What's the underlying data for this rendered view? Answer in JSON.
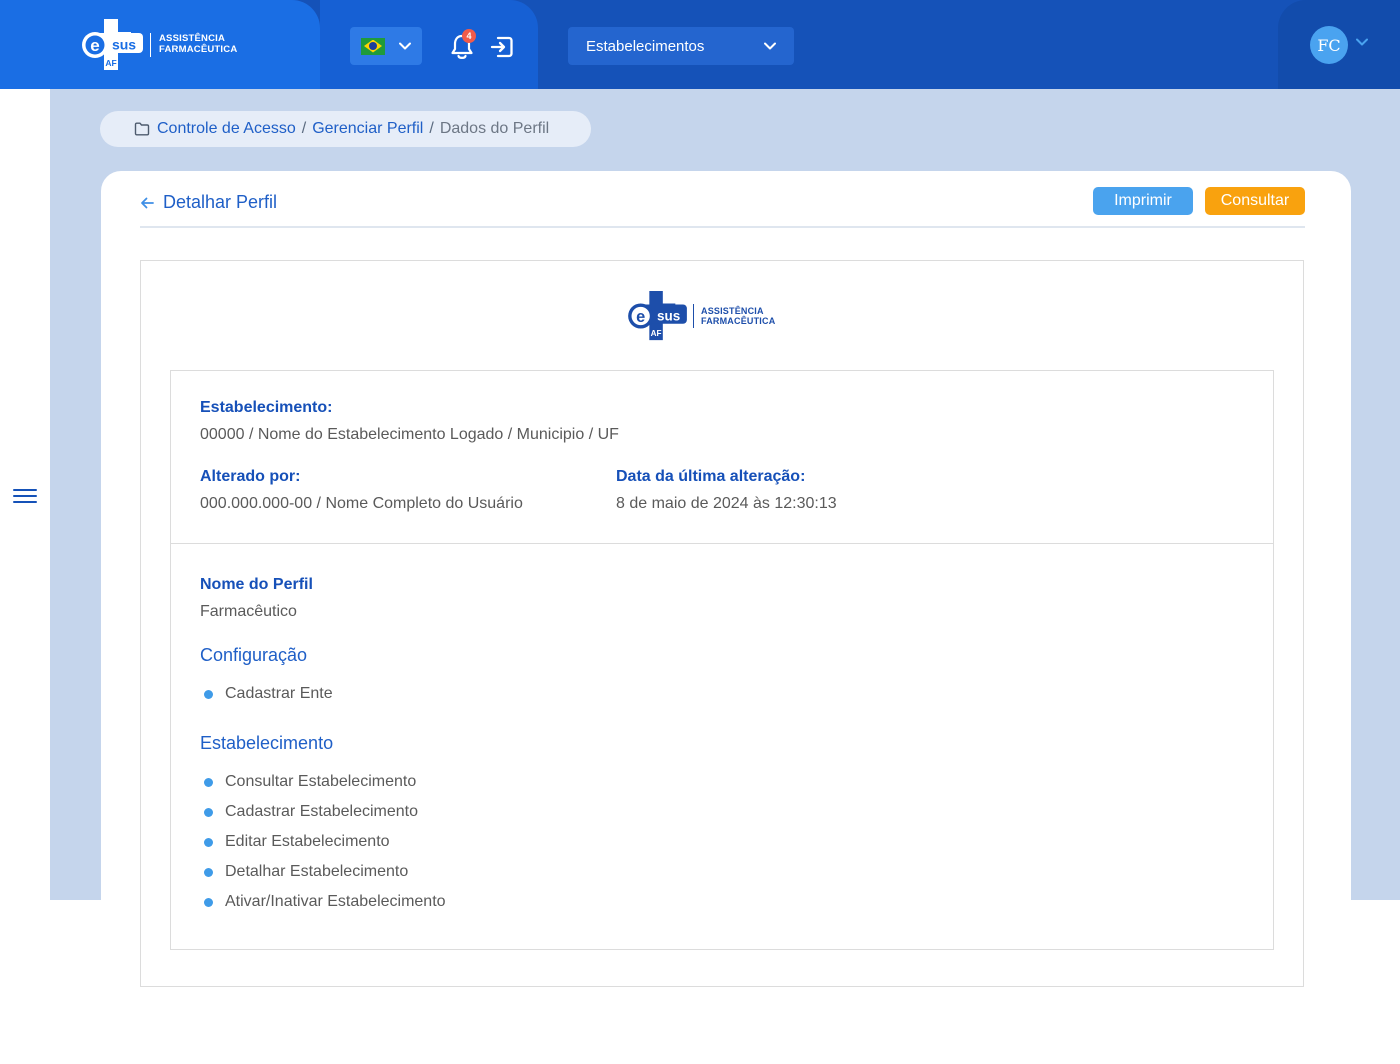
{
  "header": {
    "brand": {
      "logo_main": "sus",
      "logo_sub": "AF",
      "line1": "ASSISTÊNCIA",
      "line2": "FARMACÊUTICA"
    },
    "language": {
      "flag": "brazil-flag-icon"
    },
    "notifications": {
      "count": "4"
    },
    "establishment_select": {
      "selected": "Estabelecimentos"
    },
    "user": {
      "initials": "FC"
    }
  },
  "breadcrumb": {
    "items": [
      "Controle de Acesso",
      "Gerenciar Perfil"
    ],
    "separator": "/",
    "current": "Dados do Perfil"
  },
  "page": {
    "title": "Detalhar Perfil",
    "print_label": "Imprimir",
    "query_label": "Consultar"
  },
  "document": {
    "brand": {
      "logo_main": "sus",
      "logo_sub": "AF",
      "line1": "ASSISTÊNCIA",
      "line2": "FARMACÊUTICA"
    },
    "establishment_label": "Estabelecimento:",
    "establishment_value": "00000 / Nome do Estabelecimento Logado / Municipio / UF",
    "changed_by_label": "Alterado por:",
    "changed_by_value": "000.000.000-00 / Nome Completo do Usuário",
    "last_change_label": "Data da última alteração:",
    "last_change_value": "8 de maio de 2024 às 12:30:13",
    "profile_name_label": "Nome do Perfil",
    "profile_name_value": "Farmacêutico",
    "groups": [
      {
        "title": "Configuração",
        "items": [
          "Cadastrar Ente"
        ]
      },
      {
        "title": "Estabelecimento",
        "items": [
          "Consultar Estabelecimento",
          "Cadastrar Estabelecimento",
          "Editar Estabelecimento",
          "Detalhar Estabelecimento",
          "Ativar/Inativar Estabelecimento"
        ]
      }
    ]
  },
  "colors": {
    "primary": "#1a6ee4",
    "accent_blue": "#4aa3ee",
    "accent_orange": "#f9a20e",
    "background": "#c5d5ec"
  }
}
